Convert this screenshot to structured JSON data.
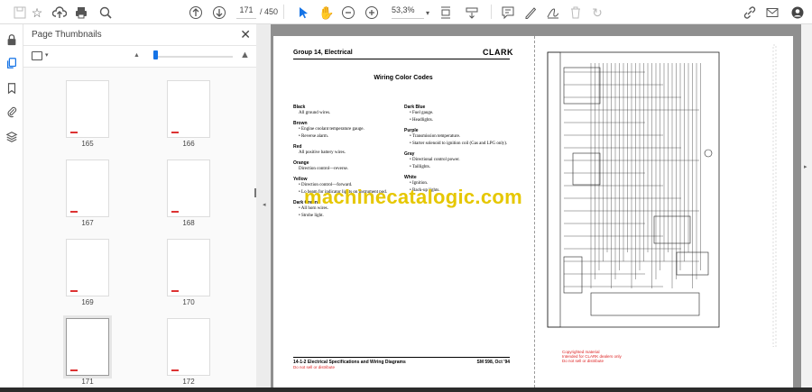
{
  "toolbar": {
    "page_current": "171",
    "page_total": "/ 450",
    "zoom": "53,3%"
  },
  "panel": {
    "title": "Page Thumbnails",
    "close": "✕"
  },
  "thumbnails": [
    {
      "label": "165"
    },
    {
      "label": "166"
    },
    {
      "label": "167"
    },
    {
      "label": "168"
    },
    {
      "label": "169"
    },
    {
      "label": "170"
    },
    {
      "label": "171",
      "selected": true
    },
    {
      "label": "172"
    }
  ],
  "document": {
    "header": "Group 14, Electrical",
    "logo": "CLARK",
    "title": "Wiring Color Codes",
    "left_column": [
      {
        "name": "Black",
        "text": "All ground wires."
      },
      {
        "name": "Brown",
        "items": [
          "Engine coolant temperature gauge.",
          "Reverse alarm."
        ]
      },
      {
        "name": "Red",
        "text": "All positive battery wires."
      },
      {
        "name": "Orange",
        "text": "Direction control—reverse."
      },
      {
        "name": "Yellow",
        "items": [
          "Direction control—forward.",
          "Lo beam for indicator lights on instrument pod."
        ]
      },
      {
        "name": "Dark Green",
        "items": [
          "All horn wires.",
          "Strobe light."
        ]
      }
    ],
    "right_column": [
      {
        "name": "Dark Blue",
        "items": [
          "Fuel gauge.",
          "Headlights."
        ]
      },
      {
        "name": "Purple",
        "items": [
          "Transmission temperature.",
          "Starter solenoid to ignition coil (Gas and LPG only)."
        ]
      },
      {
        "name": "Gray",
        "items": [
          "Directional control power.",
          "Taillights."
        ]
      },
      {
        "name": "White",
        "items": [
          "Ignition.",
          "Back-up lights."
        ]
      }
    ],
    "watermark": "machinecatalogic.com",
    "footer_left": "14-1-2   Electrical Specifications and Wiring Diagrams",
    "footer_right": "SM 598, Oct '94",
    "footer_red": "Do not sell or distribute",
    "copyright": [
      "Copyrighted material",
      "Intended for CLARK dealers only",
      "Do not sell or distribute"
    ]
  }
}
